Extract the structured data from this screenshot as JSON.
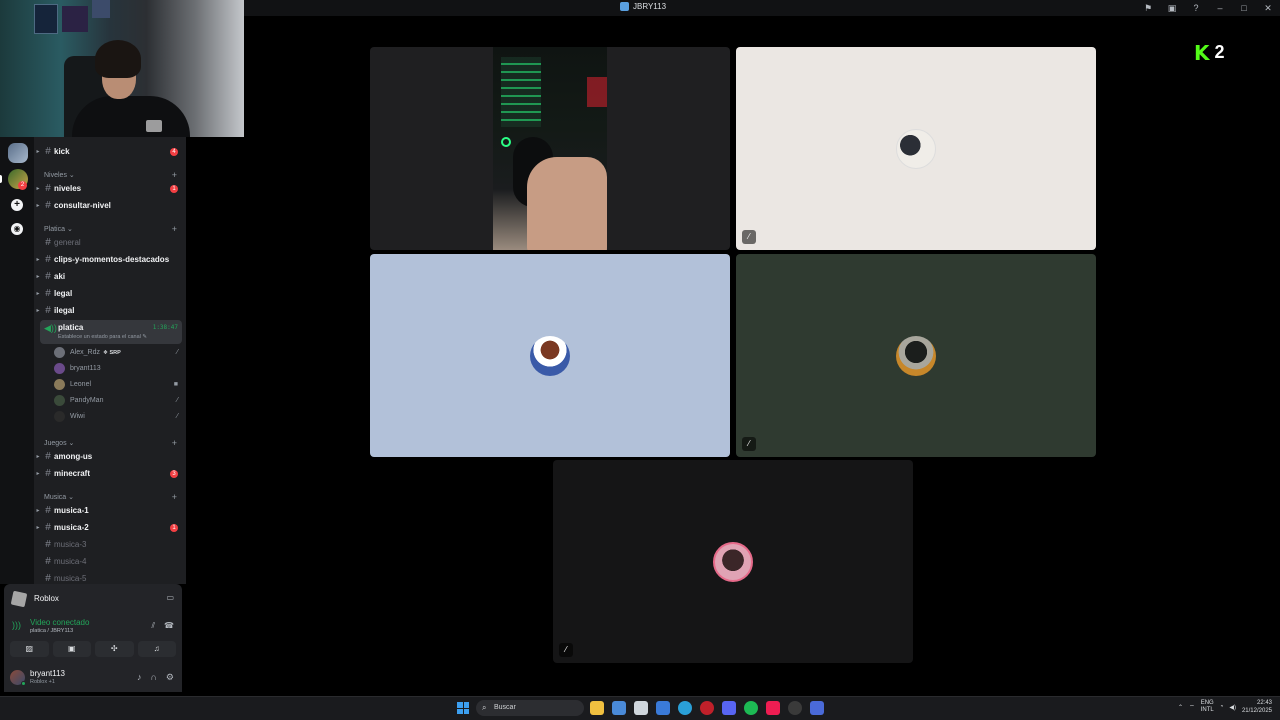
{
  "window": {
    "title": "JBRY113"
  },
  "kick": {
    "letter": "K",
    "viewers": "2"
  },
  "sidebar": {
    "top_channels": [
      {
        "name": "kick",
        "mention": "4"
      }
    ],
    "categories": [
      {
        "name": "Niveles",
        "arrow": "⌄"
      },
      {
        "name": "Platica",
        "arrow": "⌄"
      },
      {
        "name": "Juegos",
        "arrow": "⌄"
      },
      {
        "name": "Musica",
        "arrow": "⌄"
      }
    ],
    "channels": {
      "niveles": {
        "name": "niveles",
        "mention": "1"
      },
      "consultar": {
        "name": "consultar-nivel"
      },
      "general": {
        "name": "general"
      },
      "clips": {
        "name": "clips-y-momentos-destacados"
      },
      "aki": {
        "name": "aki"
      },
      "legal": {
        "name": "legal"
      },
      "ilegal": {
        "name": "ilegal"
      },
      "among": {
        "name": "among-us"
      },
      "minecraft": {
        "name": "minecraft",
        "mention": "3"
      },
      "musica1": {
        "name": "musica-1"
      },
      "musica2": {
        "name": "musica-2",
        "mention": "1"
      },
      "musica3": {
        "name": "musica-3"
      },
      "musica4": {
        "name": "musica-4"
      },
      "musica5": {
        "name": "musica-5"
      }
    },
    "voice_channel": {
      "name": "platica",
      "time": "1:38:47",
      "status": "Establece un estado para el canal"
    },
    "voice_users": [
      {
        "name": "Alex_Rdz",
        "tag": "SRP",
        "color": "#6c6f78"
      },
      {
        "name": "bryant113",
        "color": "#6a4a8a"
      },
      {
        "name": "Leonel",
        "color": "#8a7a5a"
      },
      {
        "name": "PandyMan",
        "color": "#3a4a3a"
      },
      {
        "name": "Wiwi",
        "color": "#2a2a2a"
      }
    ]
  },
  "rail": {
    "badge": "2"
  },
  "game_panel": {
    "game": "Roblox",
    "connection": "Video conectado",
    "location": "platica / JBRY113"
  },
  "user_panel": {
    "username": "bryant113",
    "status": "Roblox +1"
  },
  "taskbar": {
    "search_placeholder": "Buscar",
    "lang_top": "ENG",
    "lang_bottom": "INTL",
    "time": "22:43",
    "date": "21/12/2025"
  },
  "colors": {
    "accent_green": "#23a55a",
    "mention_red": "#f23f43",
    "kick_green": "#53fc18"
  }
}
